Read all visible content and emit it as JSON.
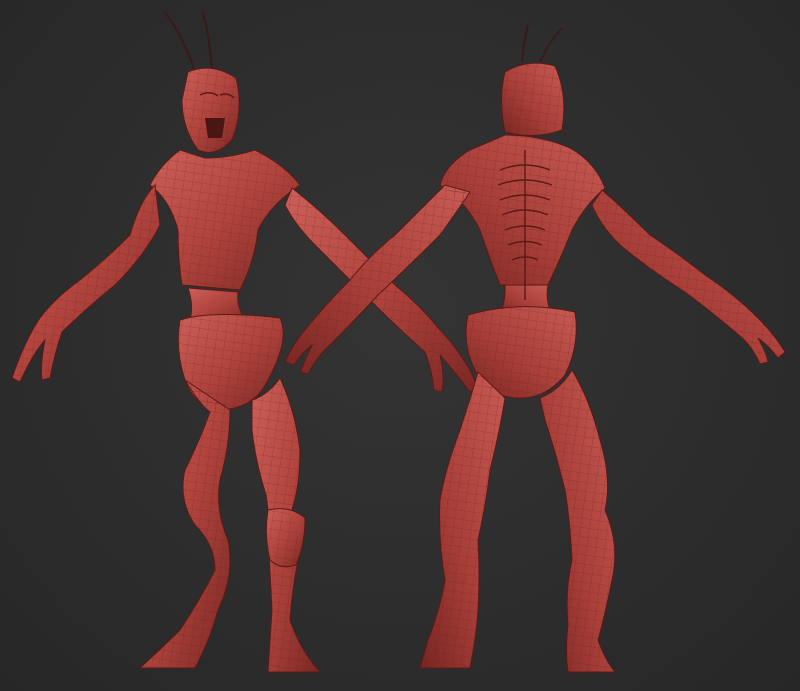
{
  "scene": {
    "background_color": "#2c2c2c",
    "model_color": "#b5463f",
    "model_shadow_color": "#6e1f1c",
    "model_highlight_color": "#d0706a",
    "wireframe_color": "#7a2622",
    "views": [
      "front",
      "back"
    ]
  }
}
